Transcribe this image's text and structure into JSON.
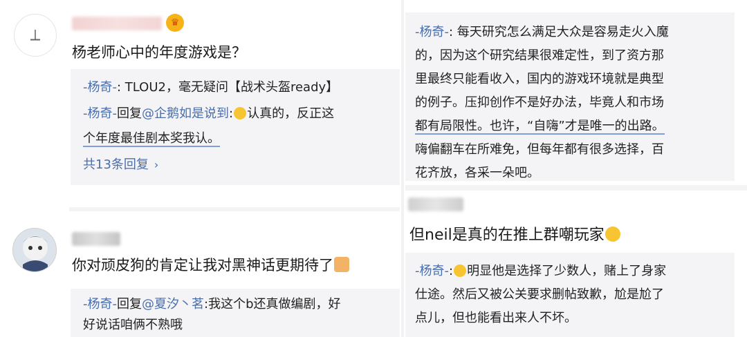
{
  "comments": {
    "c1": {
      "text": "杨老师心中的年度游戏是？",
      "replies": {
        "r1_user": "-杨奇-",
        "r1_text": ": TLOU2，毫无疑问【战术头盔ready】",
        "r2_user": "-杨奇-",
        "r2_reply": "回复",
        "r2_target": "@企鹅如是说到",
        "r2_text_a": "认真的，反正这",
        "r2_text_b": "个年度最佳剧本奖我认。",
        "more": "共13条回复"
      }
    },
    "c2": {
      "text": "你对顽皮狗的肯定让我对黑神话更期待了",
      "replies": {
        "r1_user": "-杨奇-",
        "r1_reply": "回复",
        "r1_target": "@夏汐丶茗",
        "r1_text_a": ":我这个b还真做编剧，好",
        "r1_text_b": "好说话咱俩不熟哦"
      }
    },
    "c3": {
      "user": "-杨奇-",
      "lines": [
        ": 每天研究怎么满足大众是容易走火入魔",
        "的，因为这个研究结果很难定性，到了资方那",
        "里最终只能看收入，国内的游戏环境就是典型",
        "的例子。压抑创作不是好办法，毕竟人和市场",
        "都有局限性。也许，“自嗨”才是唯一的出路。",
        "嗨偏翻车在所难免，但每年都有很多选择，百",
        "花齐放，各采一朵吧。"
      ]
    },
    "c4": {
      "text": "但neil是真的在推上群嘲玩家",
      "replies": {
        "user": "-杨奇-",
        "line1": "明显他是选择了少数人，赌上了身家",
        "line2": "仕途。然后又被公关要求删帖致歉，尬是尬了",
        "line3": "点儿，但也能看出来人不坏。"
      }
    }
  },
  "icons": {
    "avatar1": "pen-avatar-icon",
    "avatar2": "character-avatar-icon",
    "crown": "vip-crown-icon",
    "chevron": "chevron-right-icon",
    "emoji": "smile-emoji-icon",
    "thumb": "thumbs-up-icon"
  },
  "colors": {
    "username": "#4a6ea9",
    "reply_bg": "#f4f4f6"
  }
}
